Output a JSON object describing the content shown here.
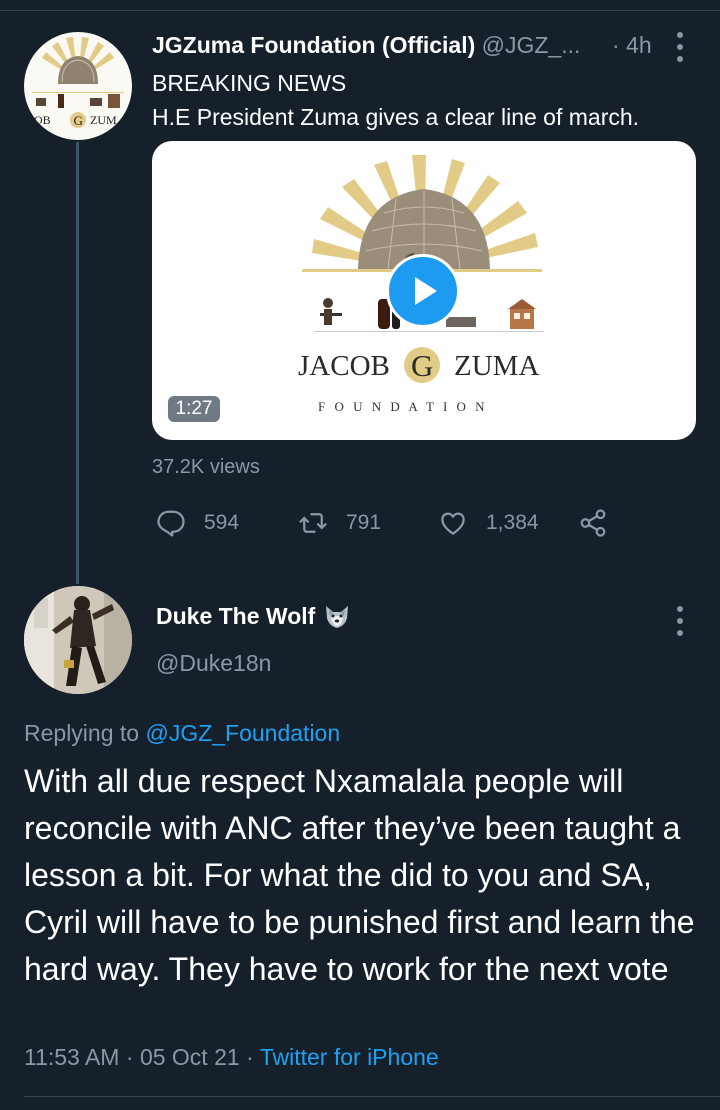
{
  "tweet1": {
    "name": "JGZuma Foundation (Official)",
    "handle": "@JGZ_...",
    "time": "· 4h",
    "line1": "BREAKING NEWS",
    "line2": "H.E President Zuma gives a clear line of march.",
    "video": {
      "duration": "1:27",
      "logo_name_left": "JACOB",
      "logo_initial": "G",
      "logo_name_right": "ZUMA",
      "logo_sub": "F O U N D A T I O N"
    },
    "views": "37.2K views",
    "stats": {
      "replies": "594",
      "retweets": "791",
      "likes": "1,384"
    },
    "avatar_text": {
      "left": "COB",
      "initial": "G",
      "right": "ZUM"
    }
  },
  "tweet2": {
    "name": "Duke The Wolf",
    "handle": "@Duke18n",
    "replying_prefix": "Replying to",
    "replying_handle": "@JGZ_Foundation",
    "body": "With all due respect Nxamalala people will reconcile with ANC after they’ve been taught a lesson a bit. For what the did to you and SA, Cyril will have to be punished first and learn the hard way. They have to work for the next vote",
    "time": "11:53 AM",
    "sep1": "·",
    "date": "05 Oct 21",
    "sep2": "·",
    "source": "Twitter for iPhone"
  },
  "icons": [
    "reply-icon",
    "retweet-icon",
    "like-icon",
    "share-icon",
    "more-icon",
    "play-icon",
    "wolf-emoji-icon"
  ],
  "colors": {
    "background": "#15202b",
    "accent": "#1da1f2",
    "muted": "#8899a6",
    "divider": "#38444d",
    "logo_gold": "#e2cb86"
  }
}
